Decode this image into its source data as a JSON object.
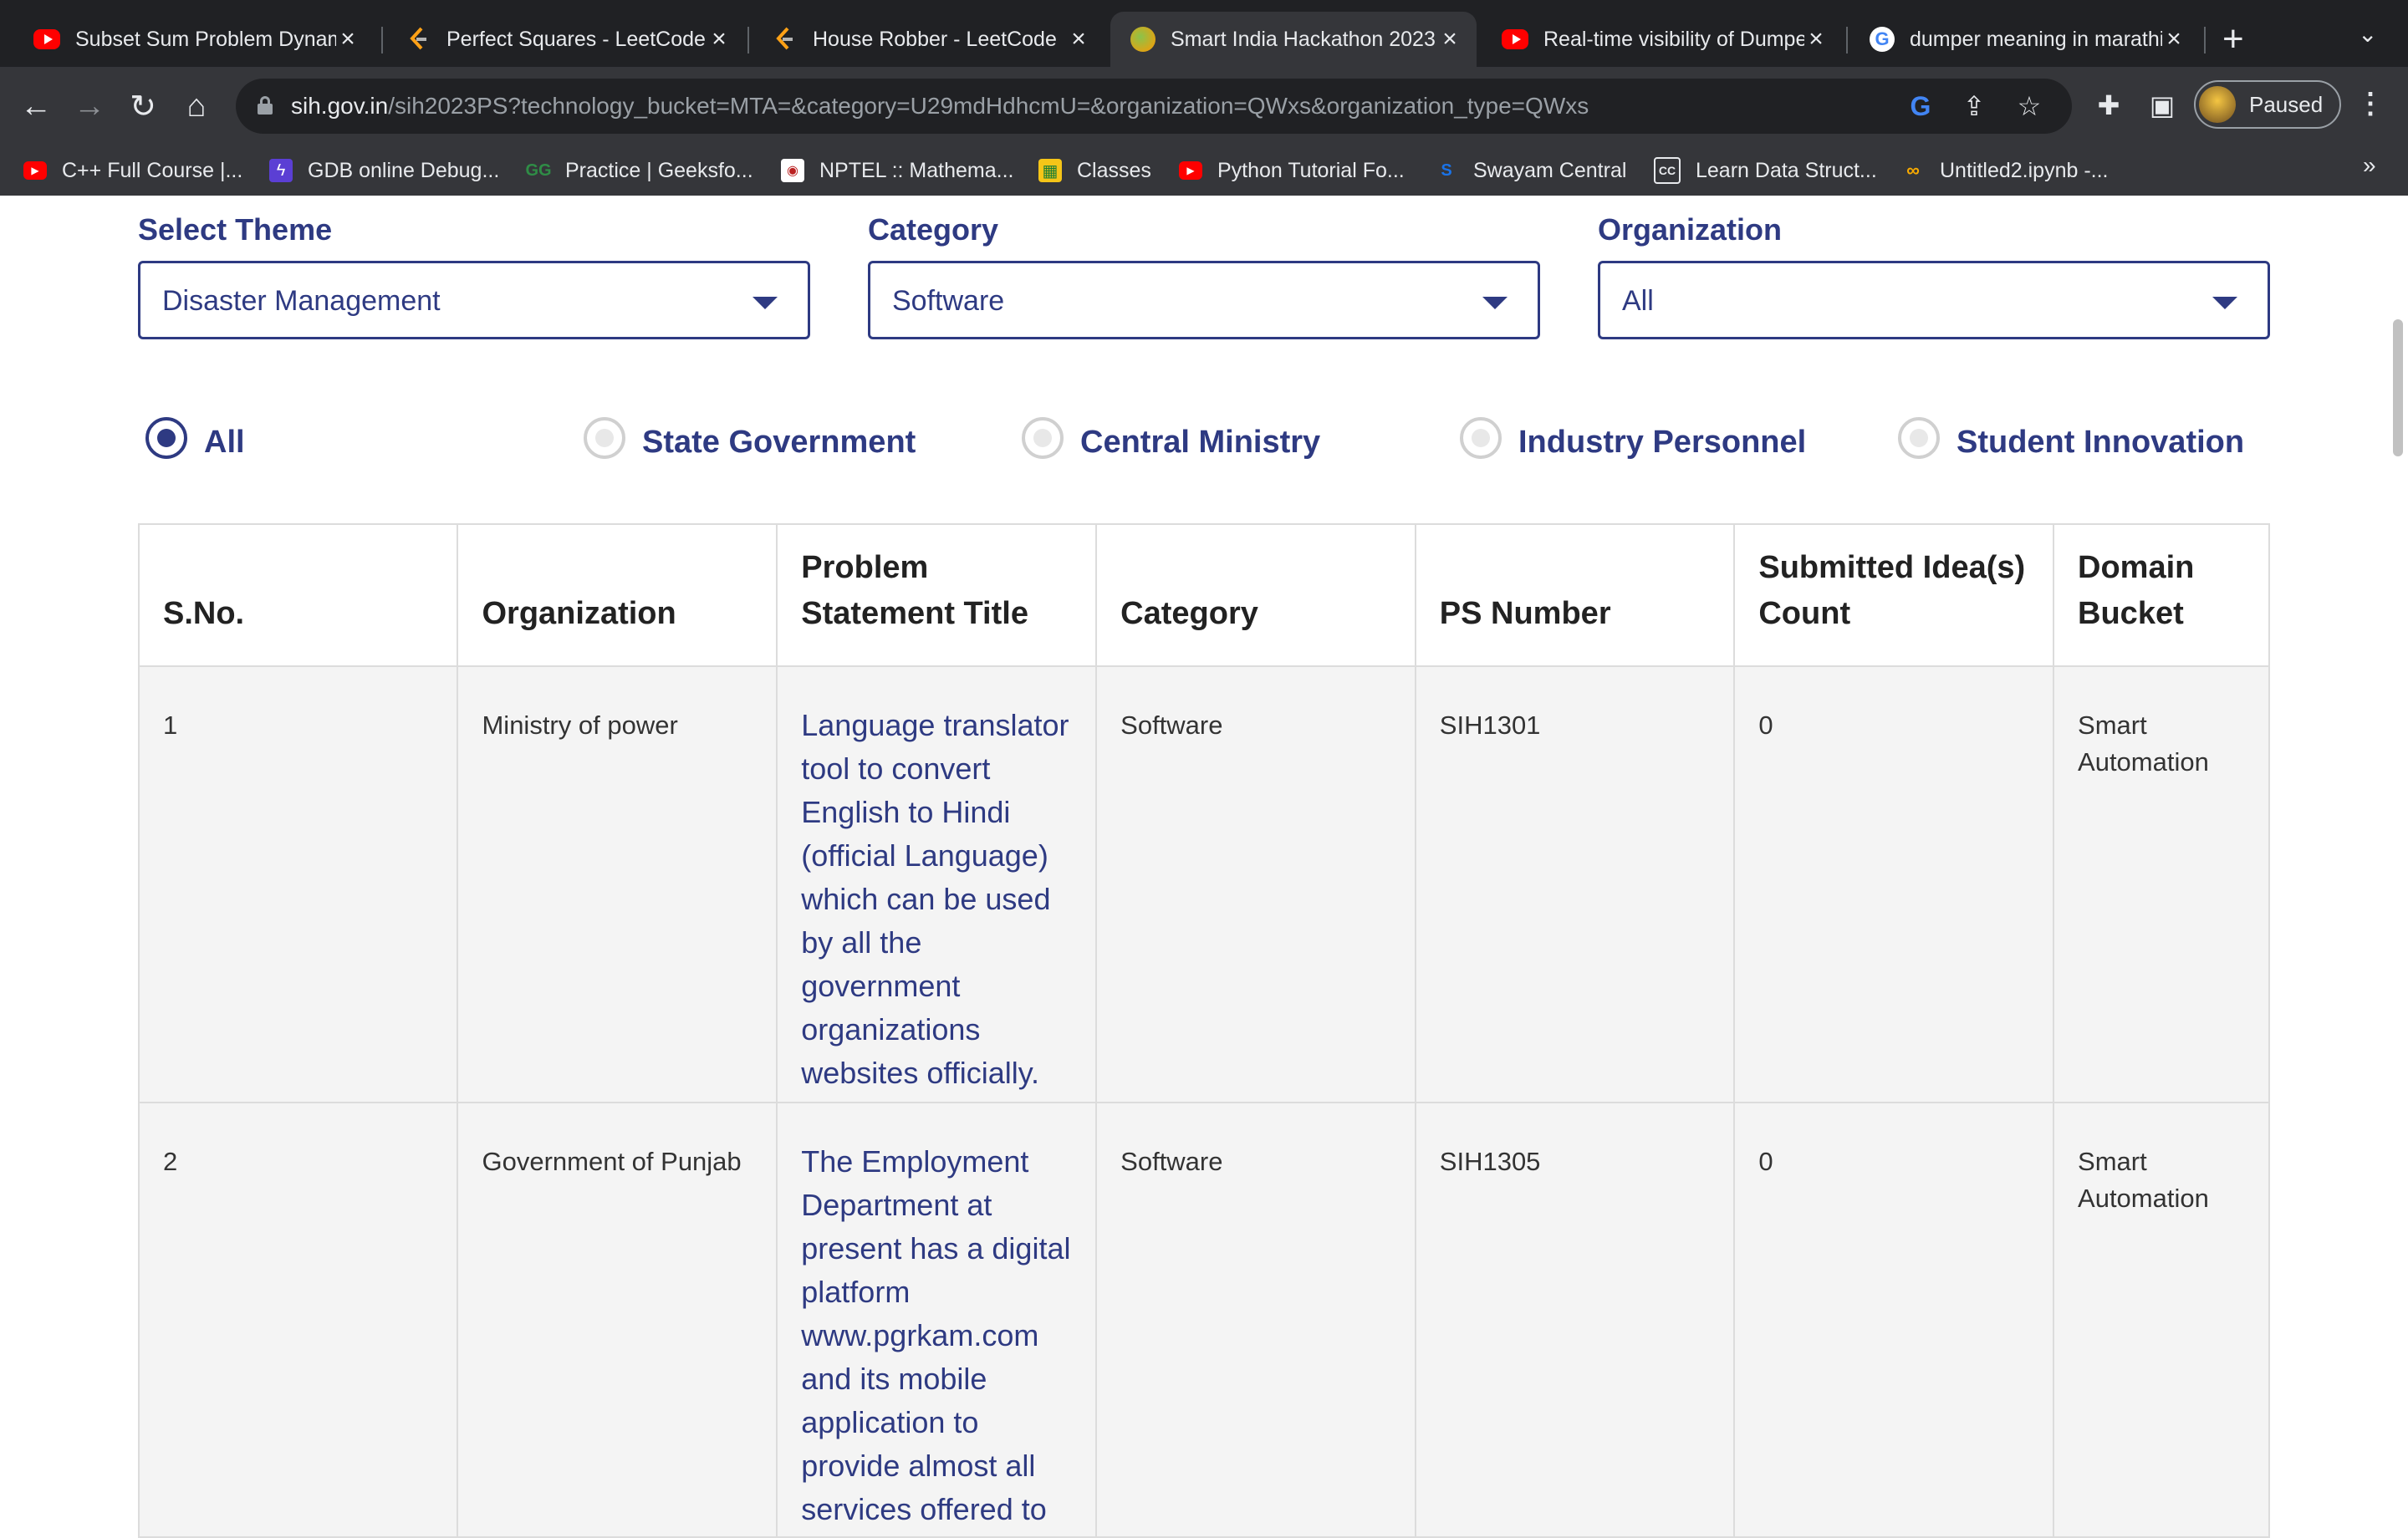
{
  "browser": {
    "tabs": [
      {
        "title": "Subset Sum Problem Dynamic",
        "favicon": "youtube-icon",
        "active": false
      },
      {
        "title": "Perfect Squares - LeetCode",
        "favicon": "leetcode-icon",
        "active": false
      },
      {
        "title": "House Robber - LeetCode",
        "favicon": "leetcode-icon",
        "active": false
      },
      {
        "title": "Smart India Hackathon 2023",
        "favicon": "sih-icon",
        "active": true
      },
      {
        "title": "Real-time visibility of Dumper",
        "favicon": "youtube-icon",
        "active": false
      },
      {
        "title": "dumper meaning in marathi",
        "favicon": "google-icon",
        "active": false
      }
    ],
    "url_host": "sih.gov.in",
    "url_path": "/sih2023PS?technology_bucket=MTA=&category=U29mdHdhcmU=&organization=QWxs&organization_type=QWxs",
    "profile_label": "Paused",
    "bookmarks": [
      {
        "label": "C++ Full Course |...",
        "icon": "youtube-icon"
      },
      {
        "label": "GDB online Debug...",
        "icon": "gdb-icon"
      },
      {
        "label": "Practice | Geeksfo...",
        "icon": "geeksforgeeks-icon"
      },
      {
        "label": "NPTEL :: Mathema...",
        "icon": "nptel-icon"
      },
      {
        "label": "Classes",
        "icon": "classroom-icon"
      },
      {
        "label": "Python Tutorial Fo...",
        "icon": "youtube-icon"
      },
      {
        "label": "Swayam Central",
        "icon": "swayam-icon"
      },
      {
        "label": "Learn Data Struct...",
        "icon": "cc-icon"
      },
      {
        "label": "Untitled2.ipynb -...",
        "icon": "colab-icon"
      }
    ]
  },
  "filters": {
    "theme_label": "Select Theme",
    "theme_value": "Disaster Management",
    "category_label": "Category",
    "category_value": "Software",
    "organization_label": "Organization",
    "organization_value": "All"
  },
  "org_types": [
    {
      "label": "All",
      "checked": true
    },
    {
      "label": "State Government",
      "checked": false
    },
    {
      "label": "Central Ministry",
      "checked": false
    },
    {
      "label": "Industry Personnel",
      "checked": false
    },
    {
      "label": "Student Innovation",
      "checked": false
    }
  ],
  "table": {
    "headers": [
      "S.No.",
      "Organization",
      "Problem Statement Title",
      "Category",
      "PS Number",
      "Submitted Idea(s) Count",
      "Domain Bucket"
    ],
    "rows": [
      {
        "sno": "1",
        "organization": "Ministry of power",
        "title": "Language translator tool to convert English to Hindi (official Language) which can be used by all the government organizations websites officially.",
        "category": "Software",
        "ps_number": "SIH1301",
        "ideas_count": "0",
        "domain": "Smart Automation"
      },
      {
        "sno": "2",
        "organization": "Government of Punjab",
        "title": "The Employment Department at present has a digital platform www.pgrkam.com and its mobile application to provide almost all services offered to",
        "category": "Software",
        "ps_number": "SIH1305",
        "ideas_count": "0",
        "domain": "Smart Automation"
      }
    ]
  },
  "colors": {
    "accent": "#2e3a82",
    "chrome_dark": "#202124",
    "chrome_toolbar": "#35363a"
  }
}
